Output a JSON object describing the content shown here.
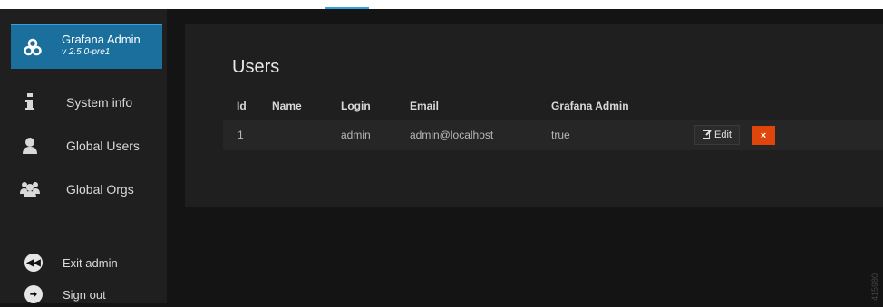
{
  "brand": {
    "title": "Grafana Admin",
    "version": "v 2.5.0-pre1"
  },
  "nav": [
    {
      "label": "System info",
      "icon": "info-icon"
    },
    {
      "label": "Global Users",
      "icon": "user-icon"
    },
    {
      "label": "Global Orgs",
      "icon": "users-group-icon"
    }
  ],
  "bottom_nav": [
    {
      "label": "Exit admin",
      "icon": "rewind-icon"
    },
    {
      "label": "Sign out",
      "icon": "sign-out-icon"
    }
  ],
  "page": {
    "title": "Users"
  },
  "table": {
    "headers": [
      "Id",
      "Name",
      "Login",
      "Email",
      "Grafana Admin"
    ],
    "rows": [
      {
        "id": "1",
        "name": "",
        "login": "admin",
        "email": "admin@localhost",
        "grafana_admin": "true"
      }
    ],
    "edit_label": "Edit",
    "delete_label": "×"
  },
  "watermark": "415980",
  "colors": {
    "accent": "#33a2e5",
    "brand_bg": "#1b6f9d",
    "danger": "#e0460b"
  }
}
